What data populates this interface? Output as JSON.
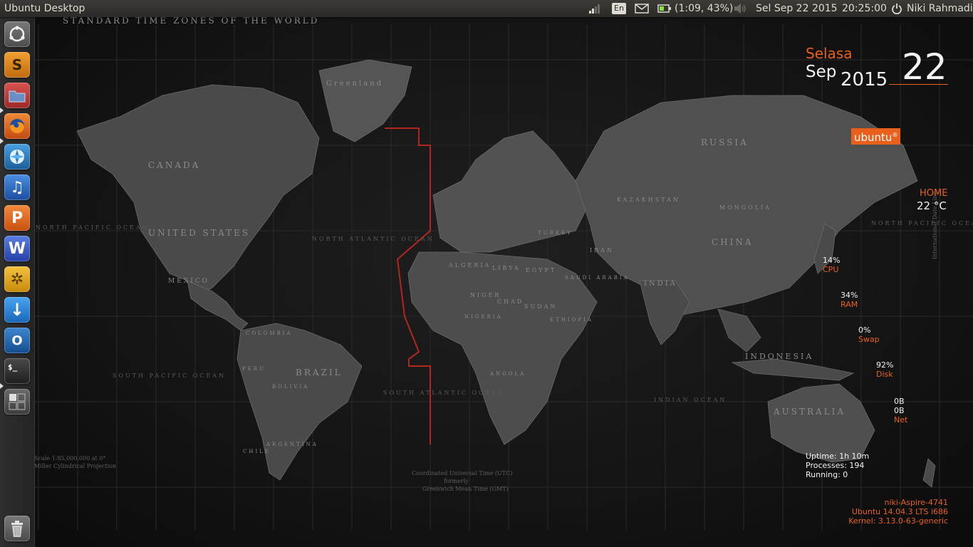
{
  "panel": {
    "title": "Ubuntu Desktop",
    "keyboard": "En",
    "battery": "(1:09, 43%)",
    "date": "Sel Sep 22 2015",
    "time": "20:25:00",
    "user": "Niki Rahmadi"
  },
  "launcher": {
    "items": [
      {
        "name": "Dash Home",
        "icon": "ubuntu-logo-icon",
        "color": "#6a6a6a"
      },
      {
        "name": "Sublime Text",
        "icon": "sublime-text-icon",
        "glyph": "S",
        "color": "#d9851d"
      },
      {
        "name": "Files",
        "icon": "files-folder-icon",
        "color": "#c0392b"
      },
      {
        "name": "Firefox",
        "icon": "firefox-icon",
        "color": "#e8601c"
      },
      {
        "name": "Shotwell",
        "icon": "shotwell-icon",
        "color": "#2b7bb9"
      },
      {
        "name": "Rhythmbox",
        "icon": "music-note-icon",
        "glyph": "♫",
        "color": "#2a6fc9"
      },
      {
        "name": "WPS Presentation",
        "icon": "wps-presentation-icon",
        "glyph": "P",
        "color": "#e06a1b"
      },
      {
        "name": "WPS Writer",
        "icon": "wps-writer-icon",
        "glyph": "W",
        "color": "#3056c4"
      },
      {
        "name": "System Settings",
        "icon": "gear-icon",
        "glyph": "✲",
        "color": "#e6a817"
      },
      {
        "name": "Software Updater",
        "icon": "download-arrow-icon",
        "glyph": "↓",
        "color": "#2f88d8"
      },
      {
        "name": "Outlook",
        "icon": "outlook-icon",
        "glyph": "O",
        "color": "#1f6bb5"
      },
      {
        "name": "Terminal",
        "icon": "terminal-icon",
        "glyph": "$_",
        "color": "#2d2d2d"
      },
      {
        "name": "Workspace Switcher",
        "icon": "workspace-switcher-icon",
        "color": "#5a5a5a"
      },
      {
        "name": "Trash",
        "icon": "trash-icon",
        "color": "#5a5a5a"
      }
    ]
  },
  "map": {
    "title": "STANDARD TIME ZONES OF THE WORLD",
    "countries": [
      "CANADA",
      "UNITED STATES",
      "BRAZIL",
      "RUSSIA",
      "CHINA",
      "INDIA",
      "AUSTRALIA",
      "INDONESIA",
      "MEXICO",
      "Greenland",
      "ALGERIA",
      "LIBYA",
      "EGYPT",
      "SUDAN",
      "KAZAKHSTAN",
      "MONGOLIA",
      "ARGENTINA",
      "PERU",
      "BOLIVIA",
      "CHILE",
      "COLOMBIA",
      "IRAN",
      "TURKEY",
      "NIGER",
      "CHAD",
      "NIGERIA",
      "ANGOLA",
      "ETHIOPIA",
      "SAUDI ARABIA"
    ],
    "oceans": [
      "NORTH PACIFIC OCEAN",
      "NORTH ATLANTIC OCEAN",
      "SOUTH PACIFIC OCEAN",
      "SOUTH ATLANTIC OCEAN",
      "INDIAN OCEAN",
      "NORTH PACIFIC OCEAN"
    ],
    "scale_note": "Scale 1:85,000,000 at 0°",
    "projection": "Miller Cylindrical Projection",
    "utc_note": "Coordinated Universal Time (UTC)",
    "utc_note2": "formerly",
    "utc_note3": "Greenwich Mean Time (GMT)",
    "date_line": "International Date Line"
  },
  "conky": {
    "day_name": "Selasa",
    "month": "Sep",
    "year": "2015",
    "day": "22",
    "distro_logo": "ubuntu",
    "weather_location": "HOME",
    "temperature": "22 °C",
    "cpu_value": "14%",
    "cpu_label": "CPU",
    "ram_value": "34%",
    "ram_label": "RAM",
    "swap_value": "0%",
    "swap_label": "Swap",
    "disk_value": "92%",
    "disk_label": "Disk",
    "net_down": "0B",
    "net_up": "0B",
    "net_label": "Net",
    "uptime": "Uptime: 1h 10m",
    "processes": "Processes: 194",
    "running": "Running: 0",
    "hostname": "niki-Aspire-4741",
    "os": "Ubuntu 14.04.3 LTS  i686",
    "kernel": "Kernel: 3.13.0-63-generic"
  },
  "colors": {
    "accent": "#e8601c",
    "panel_text": "#dfdbd2"
  }
}
